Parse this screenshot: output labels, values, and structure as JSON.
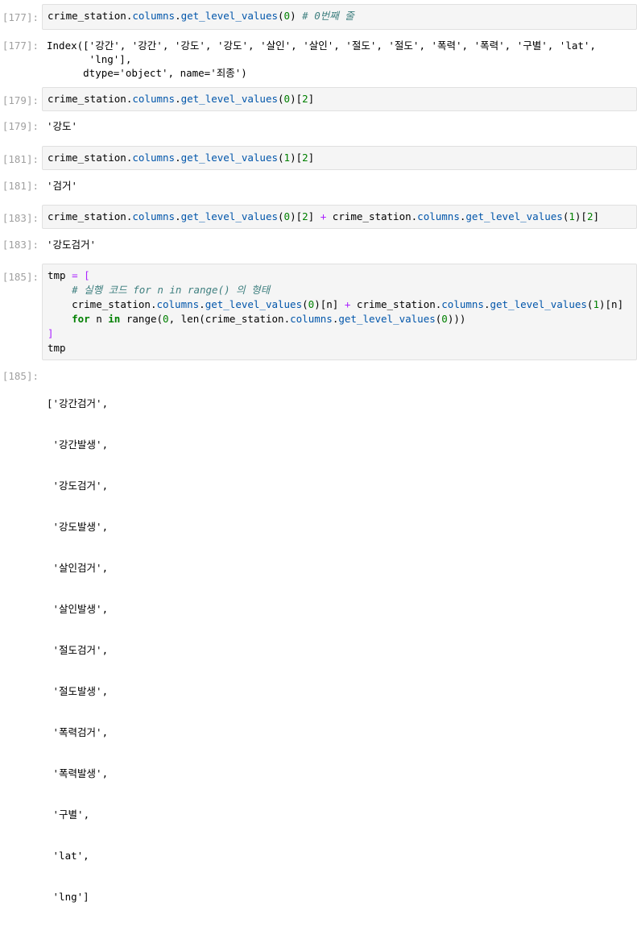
{
  "cells": [
    {
      "in_prompt": "[177]:",
      "code": {
        "obj": "crime_station",
        "attr": "columns",
        "method": "get_level_values",
        "arg": "0",
        "comment": "# 0번째 줄"
      },
      "out_prompt": "[177]:",
      "output_lines": [
        "Index(['강간', '강간', '강도', '강도', '살인', '살인', '절도', '절도', '폭력', '폭력', '구별', 'lat',",
        "       'lng'],",
        "      dtype='object', name='죄종')"
      ]
    },
    {
      "in_prompt": "[179]:",
      "code": {
        "obj": "crime_station",
        "attr": "columns",
        "method": "get_level_values",
        "arg": "0",
        "index": "2"
      },
      "out_prompt": "[179]:",
      "output_lines": [
        "'강도'"
      ]
    },
    {
      "in_prompt": "[181]:",
      "code": {
        "obj": "crime_station",
        "attr": "columns",
        "method": "get_level_values",
        "arg": "1",
        "index": "2"
      },
      "out_prompt": "[181]:",
      "output_lines": [
        "'검거'"
      ]
    },
    {
      "in_prompt": "[183]:",
      "code": {
        "obj": "crime_station",
        "attr": "columns",
        "method": "get_level_values",
        "arg": "0",
        "index": "2",
        "op": "+",
        "arg2": "1",
        "index2": "2"
      },
      "out_prompt": "[183]:",
      "output_lines": [
        "'강도검거'"
      ]
    },
    {
      "in_prompt": "[185]:",
      "code": {
        "line1_var": "tmp",
        "line1_eq": "=",
        "line1_bracket": "[",
        "comment": "# 실행 코드 for n in range() 의 형태",
        "line3_obj": "crime_station",
        "line3_attr": "columns",
        "line3_method": "get_level_values",
        "line3_arg0": "0",
        "line3_idx": "n",
        "line3_op": "+",
        "line3_arg1": "1",
        "for_kw": "for",
        "var_n": "n",
        "in_kw": "in",
        "range_fn": "range",
        "zero": "0",
        "len_fn": "len",
        "close_bracket": "]",
        "last_line": "tmp"
      },
      "out_prompt": "[185]:",
      "output_lines": [
        "['강간검거',",
        " '강간발생',",
        " '강도검거',",
        " '강도발생',",
        " '살인검거',",
        " '살인발생',",
        " '절도검거',",
        " '절도발생',",
        " '폭력검거',",
        " '폭력발생',",
        " '구별',",
        " 'lat',",
        " 'lng']"
      ]
    }
  ]
}
